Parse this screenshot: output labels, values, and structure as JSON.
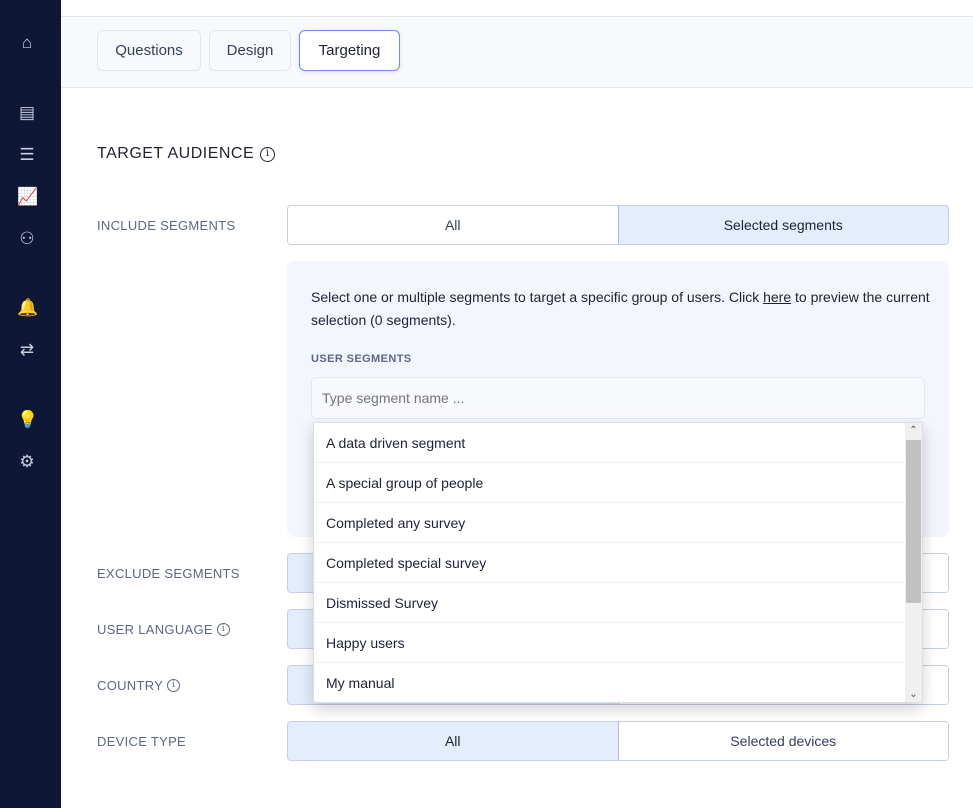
{
  "sidebar": {
    "icons": [
      "home-icon",
      "list-icon",
      "menu-icon",
      "analytics-icon",
      "audience-icon",
      "bell-icon",
      "sync-icon",
      "lightbulb-icon",
      "gear-icon"
    ]
  },
  "tabs": [
    {
      "label": "Questions"
    },
    {
      "label": "Design"
    },
    {
      "label": "Targeting",
      "active": true
    }
  ],
  "section": {
    "title": "TARGET AUDIENCE"
  },
  "include": {
    "label": "INCLUDE SEGMENTS",
    "options": [
      "All",
      "Selected segments"
    ],
    "selected": "Selected segments"
  },
  "panel": {
    "text_before": "Select one or multiple segments to target a specific group of users. Click ",
    "link": "here",
    "text_after": " to preview the current selection (0 segments).",
    "label": "USER SEGMENTS",
    "placeholder": "Type segment name ..."
  },
  "dropdown": {
    "items": [
      "A data driven segment",
      "A special group of people",
      "Completed any survey",
      "Completed special survey",
      "Dismissed Survey",
      "Happy users",
      "My manual"
    ]
  },
  "rows": {
    "exclude": {
      "label": "EXCLUDE SEGMENTS"
    },
    "language": {
      "label": "USER LANGUAGE"
    },
    "country": {
      "label": "COUNTRY"
    },
    "device": {
      "label": "DEVICE TYPE",
      "options": [
        "All",
        "Selected devices"
      ],
      "selected": "All"
    }
  },
  "colors": {
    "sidebar": "#0f1737",
    "accent": "#6c8cf5",
    "selected": "#e3edfb"
  }
}
